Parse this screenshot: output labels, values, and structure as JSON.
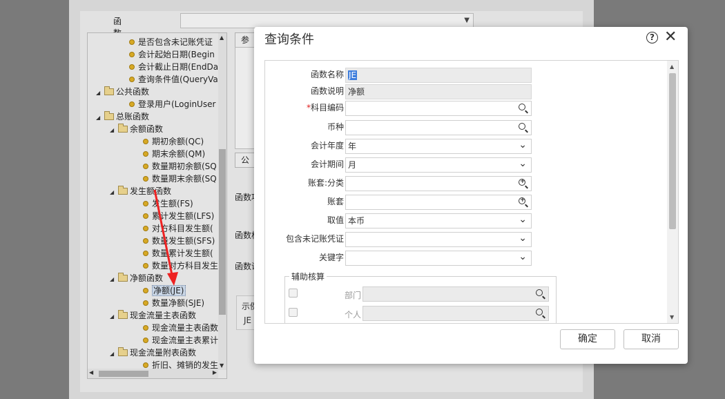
{
  "background": {
    "search": {
      "label": "函数名称或说明:",
      "value": ""
    },
    "tree": {
      "items": [
        {
          "label": "是否包含未记账凭证",
          "type": "leaf",
          "level": 3
        },
        {
          "label": "会计起始日期(Begin",
          "type": "leaf",
          "level": 3
        },
        {
          "label": "会计截止日期(EndDa",
          "type": "leaf",
          "level": 3
        },
        {
          "label": "查询条件值(QueryVa",
          "type": "leaf",
          "level": 3
        },
        {
          "label": "公共函数",
          "type": "folder",
          "level": 1
        },
        {
          "label": "登录用户(LoginUser",
          "type": "leaf",
          "level": 3
        },
        {
          "label": "总账函数",
          "type": "folder",
          "level": 1
        },
        {
          "label": "余额函数",
          "type": "folder",
          "level": 2
        },
        {
          "label": "期初余额(QC)",
          "type": "leaf",
          "level": 4
        },
        {
          "label": "期末余额(QM)",
          "type": "leaf",
          "level": 4
        },
        {
          "label": "数量期初余额(SQ",
          "type": "leaf",
          "level": 4
        },
        {
          "label": "数量期末余额(SQ",
          "type": "leaf",
          "level": 4
        },
        {
          "label": "发生额函数",
          "type": "folder",
          "level": 2
        },
        {
          "label": "发生额(FS)",
          "type": "leaf",
          "level": 4
        },
        {
          "label": "累计发生额(LFS)",
          "type": "leaf",
          "level": 4
        },
        {
          "label": "对方科目发生额(",
          "type": "leaf",
          "level": 4
        },
        {
          "label": "数量发生额(SFS)",
          "type": "leaf",
          "level": 4
        },
        {
          "label": "数量累计发生额(",
          "type": "leaf",
          "level": 4
        },
        {
          "label": "数量对方科目发生",
          "type": "leaf",
          "level": 4
        },
        {
          "label": "净额函数",
          "type": "folder",
          "level": 2
        },
        {
          "label": "净额(JE)",
          "type": "leaf",
          "level": 4,
          "selected": true
        },
        {
          "label": "数量净额(SJE)",
          "type": "leaf",
          "level": 4
        },
        {
          "label": "现金流量主表函数",
          "type": "folder",
          "level": 2
        },
        {
          "label": "现金流量主表函数",
          "type": "leaf",
          "level": 4
        },
        {
          "label": "现金流量主表累计",
          "type": "leaf",
          "level": 4
        },
        {
          "label": "现金流量附表函数",
          "type": "folder",
          "level": 2
        },
        {
          "label": "折旧、摊销的发生",
          "type": "leaf",
          "level": 4
        }
      ]
    },
    "buttons": {
      "reference": "参照",
      "formula": "公式"
    },
    "labels": {
      "func_item": "函数项",
      "func_format": "函数格",
      "func_desc": "函数说",
      "example": "示例",
      "example_value": "JE"
    }
  },
  "dialog": {
    "title": "查询条件",
    "help_icon": "question-circle-icon",
    "close_icon": "close-icon",
    "fields": [
      {
        "label": "函数名称",
        "value": "JE",
        "selected": true,
        "kind": "readonly",
        "required": false
      },
      {
        "label": "函数说明",
        "value": "净额",
        "kind": "readonly",
        "required": false
      },
      {
        "label": "科目编码",
        "value": "",
        "kind": "search",
        "required": true
      },
      {
        "label": "币种",
        "value": "",
        "kind": "search",
        "required": false
      },
      {
        "label": "会计年度",
        "value": "年",
        "kind": "select",
        "required": false
      },
      {
        "label": "会计期间",
        "value": "月",
        "kind": "select",
        "required": false
      },
      {
        "label": "账套:分类",
        "value": "",
        "kind": "search-plus",
        "required": false
      },
      {
        "label": "账套",
        "value": "",
        "kind": "search-plus",
        "required": false
      },
      {
        "label": "取值",
        "value": "本币",
        "kind": "select",
        "required": false
      },
      {
        "label": "包含未记账凭证",
        "value": "",
        "kind": "select",
        "required": false
      },
      {
        "label": "关键字",
        "value": "",
        "kind": "select",
        "required": false
      }
    ],
    "aux": {
      "title": "辅助核算",
      "items": [
        {
          "label": "部门",
          "value": ""
        },
        {
          "label": "个人",
          "value": ""
        }
      ]
    },
    "confirm_label": "确定",
    "cancel_label": "取消"
  },
  "colors": {
    "accent_selection": "#3d7ddc",
    "required_mark": "#e02020",
    "arrow": "#ee2222"
  }
}
